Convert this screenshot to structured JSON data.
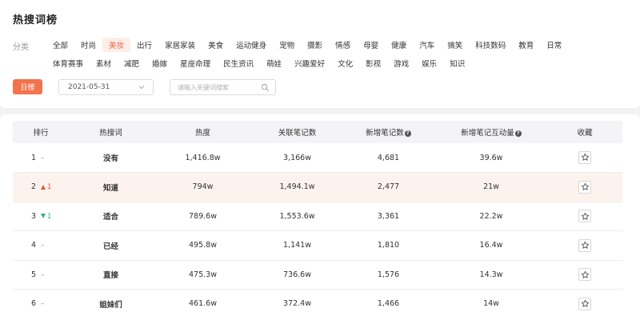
{
  "page": {
    "title": "热搜词榜"
  },
  "filters": {
    "category_label": "分类",
    "categories_row1": [
      "全部",
      "时尚",
      "美妆",
      "出行",
      "家居家装",
      "美食",
      "运动健身",
      "宠物",
      "摄影",
      "情感",
      "母婴",
      "健康",
      "汽车",
      "搞笑",
      "科技数码",
      "教育",
      "日常"
    ],
    "categories_row2": [
      "体育赛事",
      "素材",
      "减肥",
      "婚嫁",
      "星座命理",
      "民生资讯",
      "萌娃",
      "兴趣爱好",
      "文化",
      "影视",
      "游戏",
      "娱乐",
      "知识"
    ],
    "active_category": "美妆",
    "daily_button": "日榜",
    "date_value": "2021-05-31",
    "search_placeholder": "请输入关键词搜索"
  },
  "table": {
    "headers": [
      "排行",
      "热搜词",
      "热度",
      "关联笔记数",
      "新增笔记数",
      "新增笔记互动量",
      "收藏"
    ],
    "help_icon": "question-circle-icon",
    "rows": [
      {
        "rank": "1",
        "change": "–",
        "change_dir": "flat",
        "word": "没有",
        "heat": "1,416.8w",
        "related_notes": "3,166w",
        "new_notes": "4,681",
        "new_interactions": "39.6w"
      },
      {
        "rank": "2",
        "change": "1",
        "change_dir": "up",
        "word": "知道",
        "heat": "794w",
        "related_notes": "1,494.1w",
        "new_notes": "2,477",
        "new_interactions": "21w"
      },
      {
        "rank": "3",
        "change": "1",
        "change_dir": "down",
        "word": "适合",
        "heat": "789.6w",
        "related_notes": "1,553.6w",
        "new_notes": "3,361",
        "new_interactions": "22.2w"
      },
      {
        "rank": "4",
        "change": "–",
        "change_dir": "flat",
        "word": "已经",
        "heat": "495.8w",
        "related_notes": "1,141w",
        "new_notes": "1,810",
        "new_interactions": "16.4w"
      },
      {
        "rank": "5",
        "change": "–",
        "change_dir": "flat",
        "word": "直接",
        "heat": "475.3w",
        "related_notes": "736.6w",
        "new_notes": "1,576",
        "new_interactions": "14.3w"
      },
      {
        "rank": "6",
        "change": "–",
        "change_dir": "flat",
        "word": "姐妹们",
        "heat": "461.6w",
        "related_notes": "372.4w",
        "new_notes": "1,466",
        "new_interactions": "14w"
      }
    ],
    "favorite_icon": "star-outline-icon",
    "highlight_color": "#fdf3ee"
  },
  "colors": {
    "accent": "#f2744d",
    "up": "#e8573a",
    "down": "#2fb37a"
  }
}
